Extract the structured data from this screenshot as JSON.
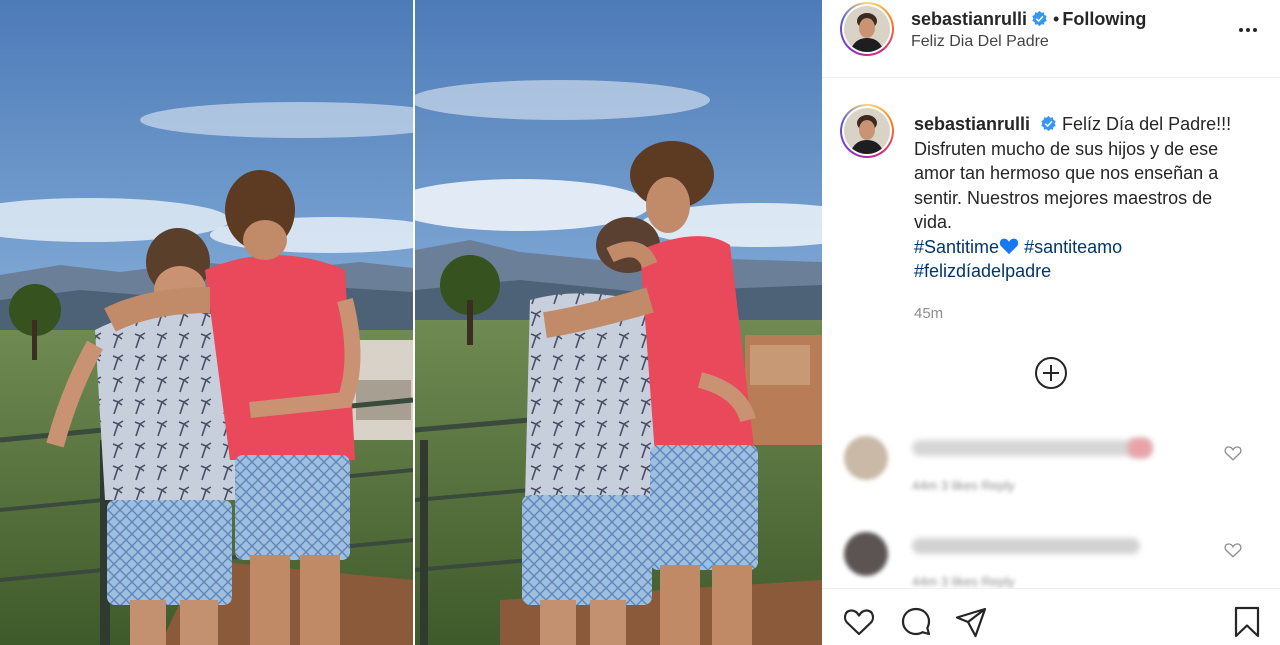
{
  "post": {
    "username": "sebastianrulli",
    "follow_separator": "•",
    "follow_state": "Following",
    "location": "Feliz Dia Del Padre",
    "caption_line1": "Felíz Día del Padre!!!",
    "caption_body": "Disfruten mucho de sus hijos y de ese amor tan hermoso que nos enseñan a sentir. Nuestros mejores maestros de vida.",
    "hashtags": [
      "#Santitime",
      "#santiteamo",
      "#felizdíadelpadre"
    ],
    "timestamp": "45m"
  },
  "comments": [
    {
      "meta": "44m  3 likes  Reply"
    },
    {
      "meta": "44m  3 likes  Reply"
    }
  ],
  "icons": {
    "verified": "verified-badge-icon",
    "more": "more-options-icon",
    "load_more": "plus-circle-icon",
    "like": "heart-icon",
    "comment": "comment-bubble-icon",
    "share": "paper-plane-icon",
    "save": "bookmark-icon"
  },
  "colors": {
    "verified_blue": "#3897f0",
    "hashtag": "#00376b",
    "heart_emoji": "#1877f2",
    "muted": "#8e8e8e"
  }
}
